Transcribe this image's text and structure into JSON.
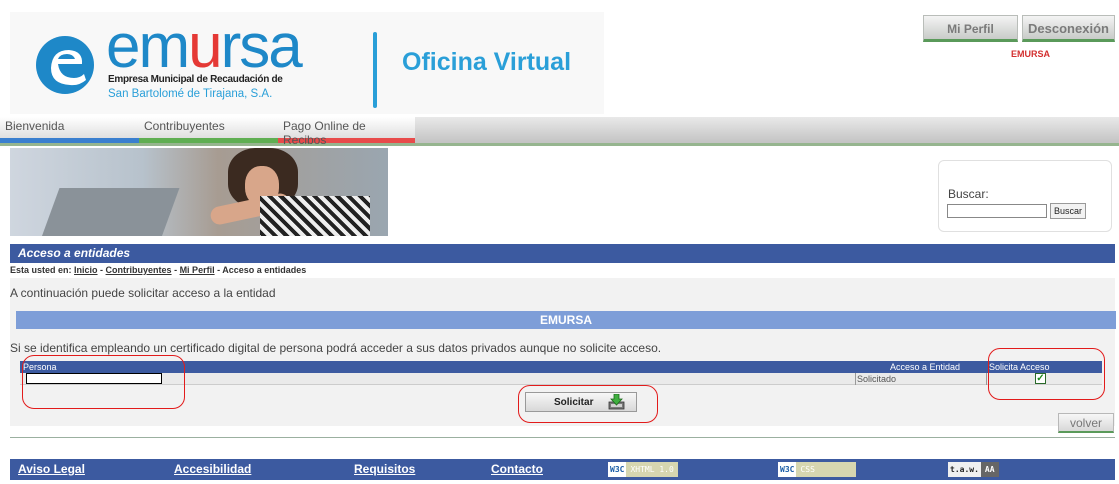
{
  "header": {
    "logo_word_a": "em",
    "logo_word_u": "u",
    "logo_word_b": "rsa",
    "logo_sub1": "Empresa Municipal de Recaudación de",
    "logo_sub2": "San Bartolomé de Tirajana, S.A.",
    "title": "Oficina Virtual",
    "btn_perfil": "Mi Perfil",
    "btn_desconexion": "Desconexión",
    "entity": "EMURSA"
  },
  "nav": {
    "tabs": [
      {
        "label": "Bienvenida"
      },
      {
        "label": "Contribuyentes"
      },
      {
        "label": "Pago Online de Recibos"
      }
    ]
  },
  "search": {
    "label": "Buscar:",
    "value": "",
    "button": "Buscar"
  },
  "section": {
    "title": "Acceso a entidades",
    "breadcrumb_prefix": "Esta usted en:",
    "crumbs": [
      "Inicio",
      "Contribuyentes",
      "Mi Perfil"
    ],
    "current": "Acceso a entidades"
  },
  "content": {
    "intro": "A continuación puede solicitar acceso a la entidad",
    "entity_bar": "EMURSA",
    "info": "Si se identifica empleando un certificado digital de persona podrá acceder a sus datos privados aunque no solicite acceso.",
    "table": {
      "headers": [
        "Persona",
        "Acceso a Entidad",
        "Solicita Acceso"
      ],
      "row": {
        "persona": "",
        "acceso": "Solicitado",
        "solicita_checked": true,
        "check_glyph": "✓"
      }
    },
    "solicitar_button": "Solicitar",
    "volver_button": "volver"
  },
  "footer": {
    "links": [
      "Aviso Legal",
      "Accesibilidad",
      "Requisitos",
      "Contacto"
    ],
    "badges": {
      "xhtml_a": "W3C",
      "xhtml_b": "XHTML 1.0",
      "css_a": "W3C",
      "css_b": "CSS",
      "taw_a": "t.a.w.",
      "taw_b": "AA"
    }
  },
  "colors": {
    "brand_blue": "#2a9fd8",
    "section_blue": "#3c5aa0",
    "emursa_bar": "#7e9ed8",
    "highlight_red": "#e21b1b"
  }
}
